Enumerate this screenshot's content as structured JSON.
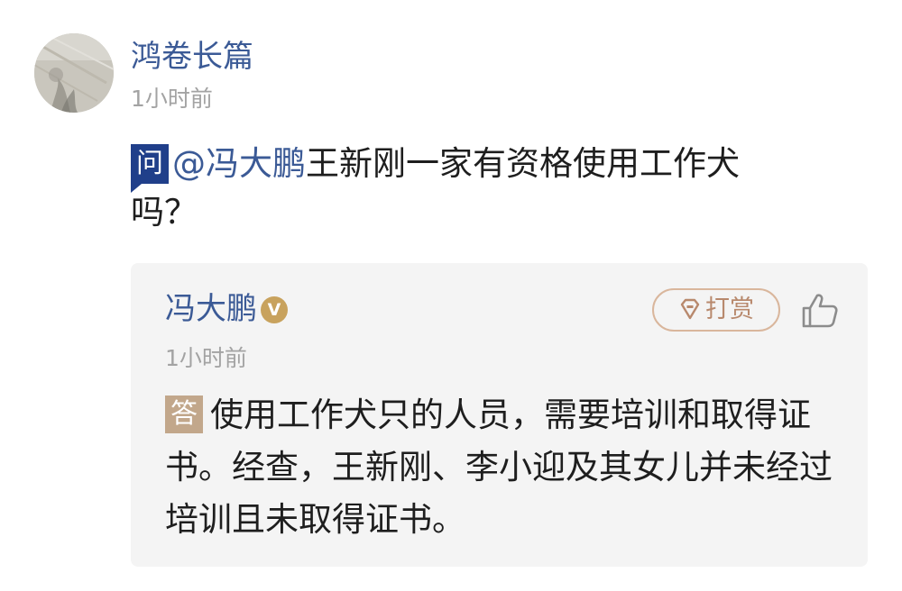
{
  "asker": {
    "name": "鸿卷长篇",
    "time": "1小时前"
  },
  "question": {
    "tag": "问",
    "mention": "@冯大鹏",
    "text": "王新刚一家有资格使用工作犬吗？"
  },
  "answer": {
    "responder_name": "冯大鹏",
    "verified_badge": "V",
    "reward_label": "打赏",
    "time": "1小时前",
    "tag": "答",
    "text": "使用工作犬只的人员，需要培训和取得证书。经查，王新刚、李小迎及其女儿并未经过培训且未取得证书。"
  },
  "colors": {
    "name_link": "#3b5a96",
    "question_tag": "#203f8a",
    "answer_tag": "#c2a78b",
    "reward_border": "#d9b69c",
    "card_bg": "#f4f4f4"
  },
  "icons": {
    "reward": "diamond-icon",
    "like": "thumbs-up-icon",
    "verified": "verified-badge-icon"
  }
}
